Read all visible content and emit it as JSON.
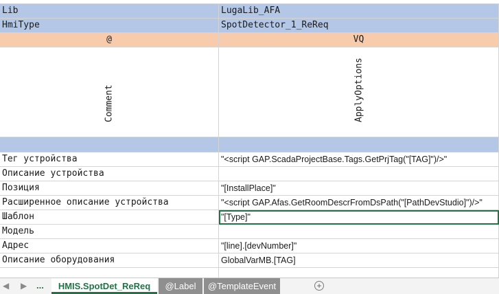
{
  "rows": {
    "lib": {
      "col1": "Lib",
      "col2": "LugaLib_AFA"
    },
    "hmitype": {
      "col1": "HmiType",
      "col2": "SpotDetector_1_ReReq"
    },
    "marker": {
      "col1": "@",
      "col2": "VQ"
    },
    "header": {
      "col1": "Comment",
      "col2": "ApplyOptions"
    },
    "data": [
      {
        "col1": "Тег устройства",
        "col2": "\"<script GAP.ScadaProjectBase.Tags.GetPrjTag(\"[TAG]\")/>\""
      },
      {
        "col1": "Описание устройства",
        "col2": ""
      },
      {
        "col1": "Позиция",
        "col2": "\"[InstallPlace]\""
      },
      {
        "col1": "Расширенное описание устройства",
        "col2": "\"<script GAP.Afas.GetRoomDescrFromDsPath(\"[PathDevStudio]\")/>\""
      },
      {
        "col1": "Шаблон",
        "col2": "\"[Type]\""
      },
      {
        "col1": "Модель",
        "col2": ""
      },
      {
        "col1": "Адрес",
        "col2": "\"[line].[devNumber]\""
      },
      {
        "col1": "Описание оборудования",
        "col2": "GlobalVarMB.[TAG]"
      }
    ]
  },
  "tabs": {
    "ellipsis": "...",
    "active": "HMIS.SpotDet_ReReq",
    "label": "@Label",
    "template_event": "@TemplateEvent",
    "add_symbol": "+"
  },
  "colors": {
    "blue": "#b4c7e7",
    "orange": "#f8cbad",
    "excel_green": "#217346"
  }
}
